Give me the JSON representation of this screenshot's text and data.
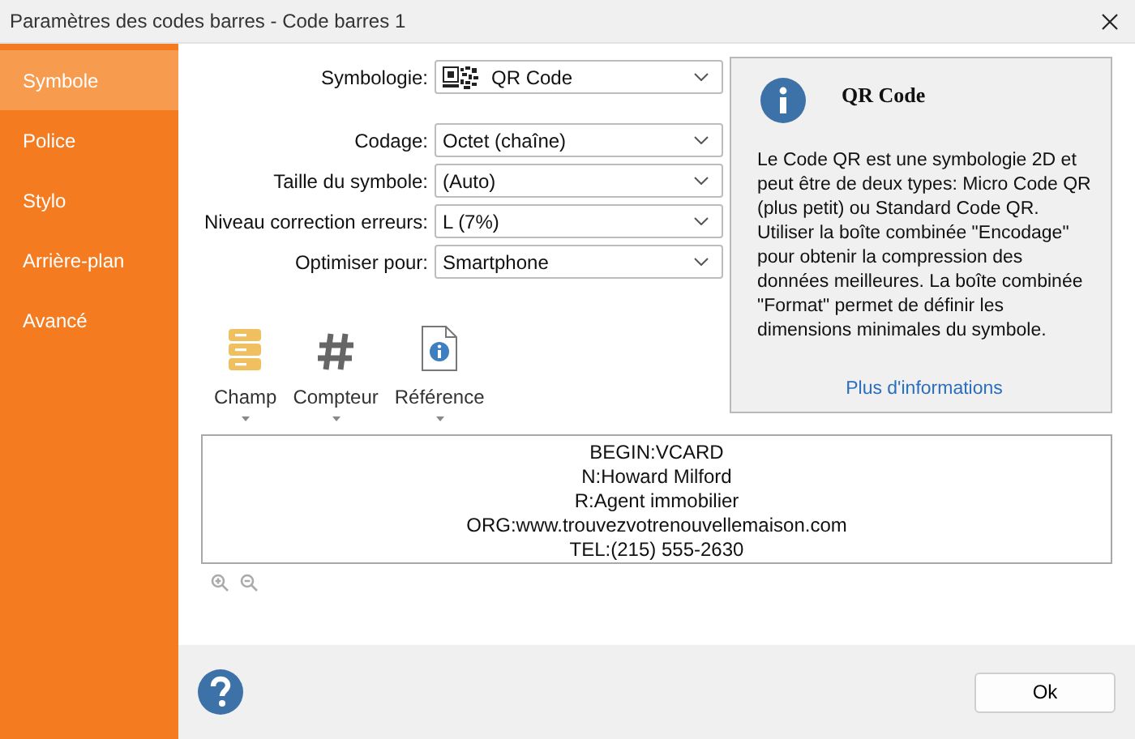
{
  "window": {
    "title": "Paramètres des codes barres - Code barres 1"
  },
  "sidebar": {
    "items": [
      {
        "label": "Symbole",
        "selected": true
      },
      {
        "label": "Police",
        "selected": false
      },
      {
        "label": "Stylo",
        "selected": false
      },
      {
        "label": "Arrière-plan",
        "selected": false
      },
      {
        "label": "Avancé",
        "selected": false
      }
    ]
  },
  "symbology": {
    "label": "Symbologie:",
    "value": "QR Code"
  },
  "settings": [
    {
      "label": "Codage:",
      "value": "Octet (chaîne)"
    },
    {
      "label": "Taille du symbole:",
      "value": "(Auto)"
    },
    {
      "label": "Niveau correction erreurs:",
      "value": "L (7%)"
    },
    {
      "label": "Optimiser pour:",
      "value": "Smartphone"
    }
  ],
  "info": {
    "title": "QR Code",
    "text": "Le Code QR est une symbologie 2D et peut être de deux types: Micro Code QR (plus petit) ou Standard Code QR. Utiliser la boîte combinée \"Encodage\" pour obtenir la compression des données meilleures. La boîte combinée \"Format\" permet de définir les dimensions minimales du symbole.",
    "link": "Plus d'informations"
  },
  "insert_tools": [
    {
      "kind": "field",
      "label": "Champ"
    },
    {
      "kind": "counter",
      "label": "Compteur"
    },
    {
      "kind": "reference",
      "label": "Référence"
    }
  ],
  "data": {
    "lines": [
      "BEGIN:VCARD",
      "N:Howard Milford",
      "R:Agent immobilier",
      "ORG:www.trouvezvotrenouvellemaison.com",
      "TEL:(215) 555-2630"
    ]
  },
  "buttons": [
    {
      "label": "Ok"
    }
  ]
}
